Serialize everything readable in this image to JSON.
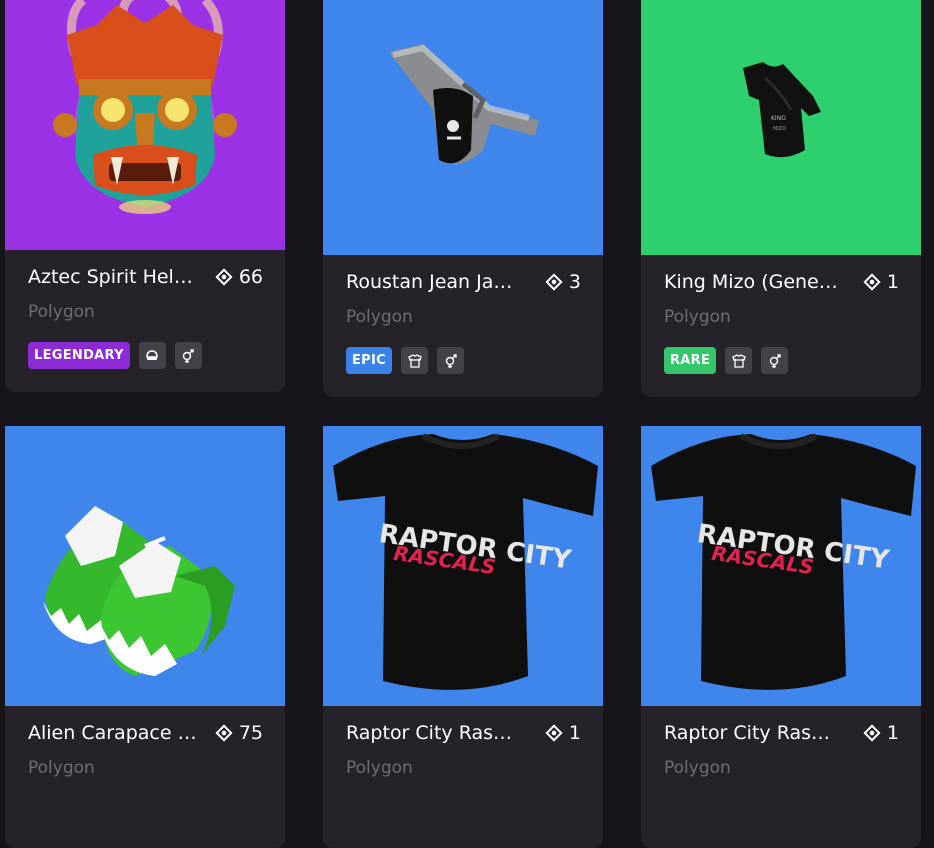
{
  "items": [
    {
      "name": "Aztec Spirit Helmet",
      "price": "66",
      "network": "Polygon",
      "rarity": "LEGENDARY",
      "rarity_color": "#8c2ad6",
      "bg": "#9b32e6",
      "category_icon": "helmet-icon",
      "gender_icon": "unisex-icon"
    },
    {
      "name": "Roustan Jean Jacket",
      "price": "3",
      "network": "Polygon",
      "rarity": "EPIC",
      "rarity_color": "#3b82e8",
      "bg": "#3f86ec",
      "category_icon": "upper-body-icon",
      "gender_icon": "unisex-icon"
    },
    {
      "name": "King Mizo (Genesis)",
      "price": "1",
      "network": "Polygon",
      "rarity": "RARE",
      "rarity_color": "#34c76a",
      "bg": "#2ecf6d",
      "category_icon": "upper-body-icon",
      "gender_icon": "unisex-icon"
    },
    {
      "name": "Alien Carapace Shoes",
      "price": "75",
      "network": "Polygon",
      "bg": "#3f86ec"
    },
    {
      "name": "Raptor City Rascals",
      "price": "1",
      "network": "Polygon",
      "bg": "#3f86ec"
    },
    {
      "name": "Raptor City Rascals",
      "price": "1",
      "network": "Polygon",
      "bg": "#3f86ec"
    }
  ],
  "currency_icon": "mana-diamond-icon",
  "shirt_print": {
    "line1": "RAPTOR CITY",
    "line2": "RASCALS"
  }
}
